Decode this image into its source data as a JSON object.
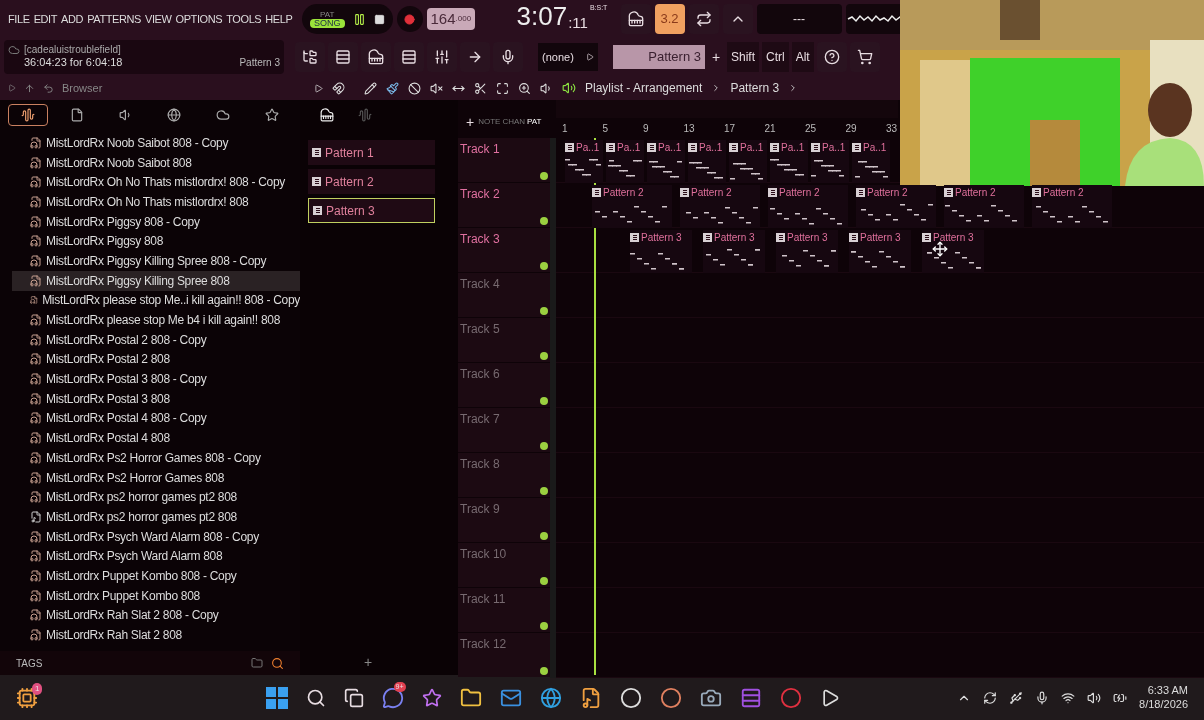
{
  "menu": [
    "FILE",
    "EDIT",
    "ADD",
    "PATTERNS",
    "VIEW",
    "OPTIONS",
    "TOOLS",
    "HELP"
  ],
  "transport": {
    "modes": [
      {
        "label": "PAT",
        "selected": false
      },
      {
        "label": "SONG",
        "selected": true
      }
    ],
    "recording": true,
    "tempo": "164",
    "tempo_fraction": ".000",
    "time": "3:07",
    "time_ticks": ":11",
    "time_unit": "B:S:T",
    "display": "---",
    "snap": "3.2"
  },
  "hint": {
    "user": "[cadealuistroublefield]",
    "timing": "36:04:23 for 6:04:18",
    "pattern": "Pattern 3"
  },
  "toolbar": {
    "channel": "(none)",
    "pattern": "Pattern 3",
    "plus": "+",
    "keys": [
      "Shift",
      "Ctrl",
      "Alt"
    ]
  },
  "browser": {
    "title": "Browser",
    "tabs": [
      {
        "kind": "wave",
        "selected": true
      },
      {
        "kind": "file",
        "selected": false
      },
      {
        "kind": "speaker",
        "selected": false
      },
      {
        "kind": "globe",
        "selected": false
      },
      {
        "kind": "cloud",
        "selected": false
      },
      {
        "kind": "star",
        "selected": false
      }
    ],
    "items": [
      {
        "name": "MistLordRx Noob Saibot 808 - Copy",
        "kind": "mp3",
        "selected": false
      },
      {
        "name": "MistLordRx Noob Saibot 808",
        "kind": "mp3",
        "selected": false
      },
      {
        "name": "MistLordRx Oh No Thats mistlordrx! 808 - Copy",
        "kind": "mp3",
        "selected": false
      },
      {
        "name": "MistLordRx Oh No Thats mistlordrx! 808",
        "kind": "mp3",
        "selected": false
      },
      {
        "name": "MistLordRx Piggsy 808 - Copy",
        "kind": "mp3",
        "selected": false
      },
      {
        "name": "MistLordRx Piggsy 808",
        "kind": "mp3",
        "selected": false
      },
      {
        "name": "MistLordRx Piggsy Killing Spree 808 - Copy",
        "kind": "mp3",
        "selected": false
      },
      {
        "name": "MistLordRx Piggsy Killing Spree 808",
        "kind": "mp3",
        "selected": true
      },
      {
        "name": "MistLordRx please stop Me..i kill again!! 808 - Copy",
        "kind": "mp3",
        "selected": false
      },
      {
        "name": "MistLordRx please stop Me b4 i kill again!! 808",
        "kind": "mp3",
        "selected": false
      },
      {
        "name": "MistLordRx Postal 2 808 - Copy",
        "kind": "mp3",
        "selected": false
      },
      {
        "name": "MistLordRx Postal 2 808",
        "kind": "mp3",
        "selected": false
      },
      {
        "name": "MistLordRx Postal 3 808 - Copy",
        "kind": "mp3",
        "selected": false
      },
      {
        "name": "MistLordRx Postal 3 808",
        "kind": "mp3",
        "selected": false
      },
      {
        "name": "MistLordRx Postal 4 808 - Copy",
        "kind": "mp3",
        "selected": false
      },
      {
        "name": "MistLordRx Postal 4 808",
        "kind": "mp3",
        "selected": false
      },
      {
        "name": "MistLordRx Ps2 Horror Games 808 - Copy",
        "kind": "mp3",
        "selected": false
      },
      {
        "name": "MistLordRx Ps2 Horror Games 808",
        "kind": "mp3",
        "selected": false
      },
      {
        "name": "MistLordRx ps2 horror games pt2 808",
        "kind": "mp3",
        "selected": false
      },
      {
        "name": "MistLordRx ps2 horror games pt2 808",
        "kind": "project",
        "selected": false
      },
      {
        "name": "MistLordRx Psych Ward Alarm 808 - Copy",
        "kind": "mp3",
        "selected": false
      },
      {
        "name": "MistLordRx Psych Ward Alarm 808",
        "kind": "mp3",
        "selected": false
      },
      {
        "name": "MistLordrx Puppet Kombo 808 - Copy",
        "kind": "mp3",
        "selected": false
      },
      {
        "name": "MistLordrx Puppet Kombo 808",
        "kind": "mp3",
        "selected": false
      },
      {
        "name": "MistLordRx Rah Slat 2 808 - Copy",
        "kind": "mp3",
        "selected": false
      },
      {
        "name": "MistLordRx Rah Slat 2 808",
        "kind": "mp3",
        "selected": false
      }
    ],
    "tags": "TAGS"
  },
  "patterns": [
    {
      "name": "Pattern 1",
      "selected": false
    },
    {
      "name": "Pattern 2",
      "selected": false
    },
    {
      "name": "Pattern 3",
      "selected": true
    }
  ],
  "pattern_add": "+",
  "playlist": {
    "title": "Playlist - Arrangement",
    "pattern": "Pattern 3",
    "add": "+",
    "filters": [
      {
        "label": "NOTE",
        "selected": false
      },
      {
        "label": "CHAN",
        "selected": false
      },
      {
        "label": "PAT",
        "selected": true
      }
    ],
    "ruler": [
      "1",
      "5",
      "9",
      "13",
      "17",
      "21",
      "25",
      "29",
      "33"
    ],
    "tracks": [
      {
        "name": "Track 1",
        "clips": [
          "Pa..1",
          "Pa..1",
          "Pa..1",
          "Pa..1",
          "Pa..1",
          "Pa..1",
          "Pa..1",
          "Pa..1"
        ]
      },
      {
        "name": "Track 2",
        "clips": [
          "Pattern 2",
          "Pattern 2",
          "Pattern 2",
          "Pattern 2",
          "Pattern 2",
          "Pattern 2"
        ]
      },
      {
        "name": "Track 3",
        "clips": [
          "Pattern 3",
          "Pattern 3",
          "Pattern 3",
          "Pattern 3",
          "Pattern 3"
        ]
      },
      {
        "name": "Track 4"
      },
      {
        "name": "Track 5"
      },
      {
        "name": "Track 6"
      },
      {
        "name": "Track 7"
      },
      {
        "name": "Track 8"
      },
      {
        "name": "Track 9"
      },
      {
        "name": "Track 10"
      },
      {
        "name": "Track 11"
      },
      {
        "name": "Track 12"
      }
    ]
  },
  "taskbar": {
    "badges": [
      {
        "kind": "start_app",
        "text": "1"
      },
      {
        "kind": "chat",
        "text": "9+"
      }
    ],
    "time": "6:33 AM",
    "date": "8/18/2026"
  }
}
